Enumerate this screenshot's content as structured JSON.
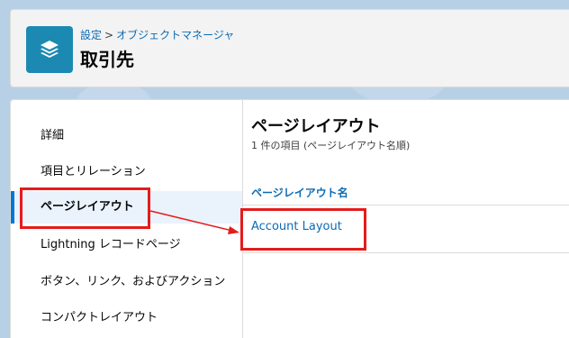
{
  "header": {
    "breadcrumb": {
      "setup": "設定",
      "separator": ">",
      "object_manager": "オブジェクトマネージャ"
    },
    "title": "取引先",
    "icon": "layers-icon"
  },
  "sidebar": {
    "items": [
      {
        "label": "詳細"
      },
      {
        "label": "項目とリレーション"
      },
      {
        "label": "ページレイアウト",
        "active": true
      },
      {
        "label": "Lightning レコードページ"
      },
      {
        "label": "ボタン、リンク、およびアクション"
      },
      {
        "label": "コンパクトレイアウト"
      }
    ]
  },
  "content": {
    "title": "ページレイアウト",
    "subtitle": "1 件の項目 (ページレイアウト名順)",
    "column_header": "ページレイアウト名",
    "rows": [
      {
        "name": "Account Layout"
      }
    ]
  },
  "colors": {
    "accent": "#0176d3",
    "link": "#0b6bb4",
    "highlight": "#e41b1b",
    "icon_bg": "#1c89b3"
  }
}
